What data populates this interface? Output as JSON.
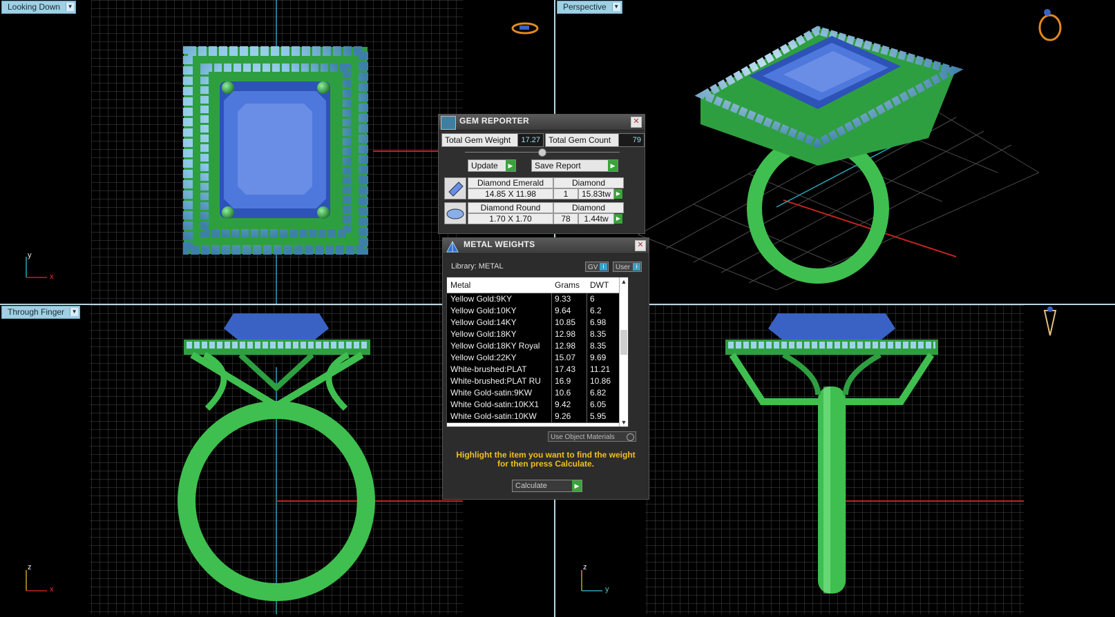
{
  "viewports": {
    "top_left": {
      "label": "Looking Down",
      "axis_v": "y",
      "axis_h": "x"
    },
    "top_right": {
      "label": "Perspective"
    },
    "bottom_left": {
      "label": "Through Finger",
      "axis_v": "z",
      "axis_h": "x"
    },
    "bottom_right": {
      "label": "",
      "axis_v": "z",
      "axis_h": "y"
    }
  },
  "gem_reporter": {
    "title": "GEM REPORTER",
    "close": "✕",
    "total_weight_label": "Total Gem Weight",
    "total_weight_value": "17.27",
    "total_count_label": "Total Gem Count",
    "total_count_value": "79",
    "update_label": "Update",
    "save_report_label": "Save Report",
    "gems": [
      {
        "name": "Diamond Emerald",
        "material": "Diamond",
        "size": "14.85 X 11.98",
        "count": "1",
        "weight": "15.83tw"
      },
      {
        "name": "Diamond Round",
        "material": "Diamond",
        "size": "1.70 X 1.70",
        "count": "78",
        "weight": "1.44tw"
      }
    ]
  },
  "metal_weights": {
    "title": "METAL WEIGHTS",
    "close": "✕",
    "library_label": "Library: METAL",
    "gv_label": "GV",
    "user_label": "User",
    "columns": [
      "Metal",
      "Grams",
      "DWT"
    ],
    "rows": [
      [
        "Yellow Gold:9KY",
        "9.33",
        "6"
      ],
      [
        "Yellow Gold:10KY",
        "9.64",
        "6.2"
      ],
      [
        "Yellow Gold:14KY",
        "10.85",
        "6.98"
      ],
      [
        "Yellow Gold:18KY",
        "12.98",
        "8.35"
      ],
      [
        "Yellow Gold:18KY Royal",
        "12.98",
        "8.35"
      ],
      [
        "Yellow Gold:22KY",
        "15.07",
        "9.69"
      ],
      [
        "White-brushed:PLAT",
        "17.43",
        "11.21"
      ],
      [
        "White-brushed:PLAT RU",
        "16.9",
        "10.86"
      ],
      [
        "White Gold-satin:9KW",
        "10.6",
        "6.82"
      ],
      [
        "White Gold-satin:10KX1",
        "9.42",
        "6.05"
      ],
      [
        "White Gold-satin:10KW",
        "9.26",
        "5.95"
      ]
    ],
    "use_object_materials": "Use Object Materials",
    "hint": "Highlight the item you want to find the weight for then press Calculate.",
    "calculate_label": "Calculate"
  },
  "colors": {
    "metal_green": "#3fbf4f",
    "gem_blue": "#3a62c4",
    "accent_diamond": "#9fd3ea",
    "grid": "#4a4a4a",
    "viewport_label": "#9fd0e4",
    "hint_text": "#f0c020"
  }
}
